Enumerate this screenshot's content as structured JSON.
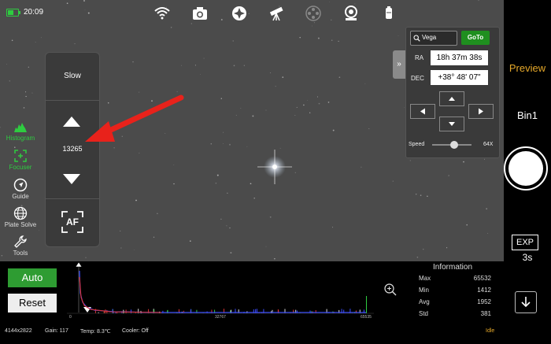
{
  "status_bar": {
    "time": "20:09",
    "battery_level": 0.6,
    "icons": [
      "wifi-icon",
      "camera-icon",
      "mount-icon",
      "telescope-icon",
      "filter-wheel-icon",
      "guide-camera-icon",
      "focuser-device-icon"
    ]
  },
  "left_toolbar": {
    "items": [
      {
        "label": "Histogram",
        "icon": "histogram-icon",
        "active": true
      },
      {
        "label": "Focuser",
        "icon": "focuser-icon",
        "active": true
      },
      {
        "label": "Guide",
        "icon": "guide-icon",
        "active": false
      },
      {
        "label": "Plate Solve",
        "icon": "globe-icon",
        "active": false
      },
      {
        "label": "Tools",
        "icon": "wrench-icon",
        "active": false
      }
    ]
  },
  "focuser": {
    "speed_label": "Slow",
    "position": "13265",
    "af_label": "AF"
  },
  "goto_panel": {
    "search_value": "Vega",
    "goto_label": "GoTo",
    "ra_label": "RA",
    "ra_value": "18h 37m 38s",
    "dec_label": "DEC",
    "dec_value": "+38° 48' 07\"",
    "speed_label": "Speed",
    "speed_value": "64X",
    "speed_level": 0.55
  },
  "right_panel": {
    "preview_label": "Preview",
    "bin_label": "Bin1",
    "exp_label": "EXP",
    "exp_time": "3s"
  },
  "histogram": {
    "auto_label": "Auto",
    "reset_label": "Reset",
    "axis_min": "0",
    "axis_mid": "32767",
    "axis_max": "65535"
  },
  "information": {
    "title": "Information",
    "rows": [
      {
        "label": "Max",
        "value": "65532"
      },
      {
        "label": "Min",
        "value": "1412"
      },
      {
        "label": "Avg",
        "value": "1952"
      },
      {
        "label": "Std",
        "value": "381"
      }
    ]
  },
  "footer": {
    "resolution": "4144x2822",
    "gain": "Gain: 117",
    "temp": "Temp: 8.3℃",
    "cooler": "Cooler: Off",
    "state": "Idle"
  },
  "colors": {
    "accent_green": "#2e9c32",
    "preview_orange": "#e5a82a",
    "annotation_red": "#e8221b"
  }
}
